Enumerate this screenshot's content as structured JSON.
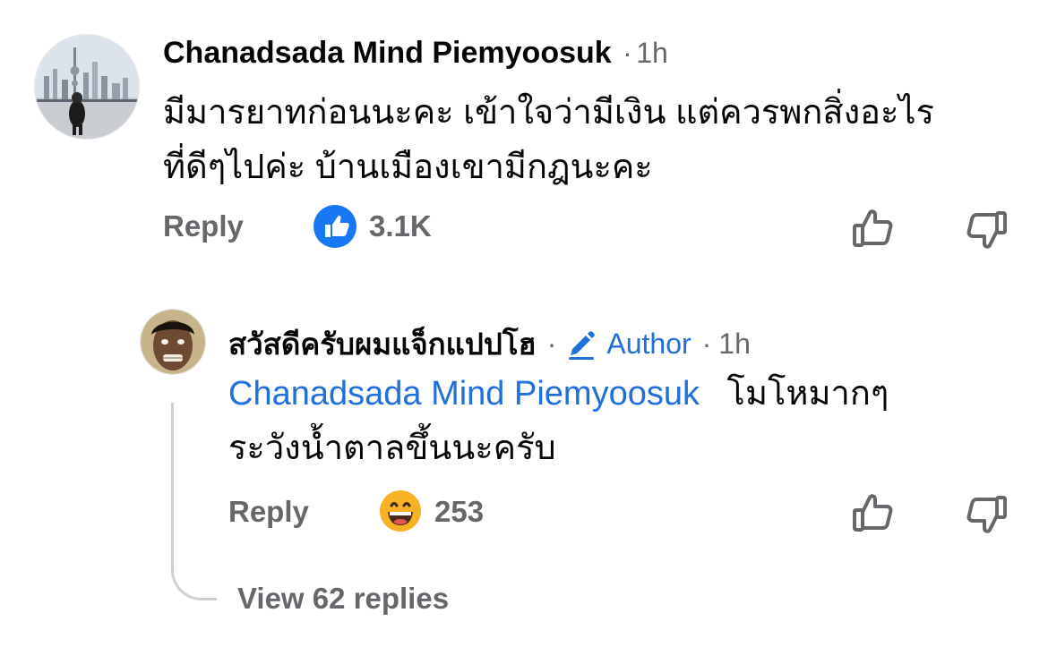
{
  "comment": {
    "author": "Chanadsada Mind Piemyoosuk",
    "separator": "·",
    "time": "1h",
    "text_line1": "มีมารยาทก่อนนะคะ เข้าใจว่ามีเงิน แต่ควรพกสิ่งอะไร",
    "text_line2": "ที่ดีๆไปค่ะ บ้านเมืองเขามีกฎนะคะ",
    "reply_label": "Reply",
    "reaction_icon": "like-reaction-icon",
    "reaction_count": "3.1K"
  },
  "reply": {
    "author": "สวัสดีครับผมแจ็กแปปโฮ",
    "separator1": "·",
    "badge_icon": "pencil-icon",
    "badge_label": "Author",
    "separator2": "·",
    "time": "1h",
    "mention": "Chanadsada Mind Piemyoosuk",
    "text_line1": "โมโหมากๆ",
    "text_line2": "ระวังน้ำตาลขึ้นนะครับ",
    "reply_label": "Reply",
    "reaction_icon": "haha-reaction-icon",
    "reaction_count": "253"
  },
  "view_replies": "View 62 replies",
  "colors": {
    "link": "#216fdb",
    "muted": "#65676b",
    "like_blue": "#1877f2",
    "haha_yellow": "#f7b125"
  }
}
